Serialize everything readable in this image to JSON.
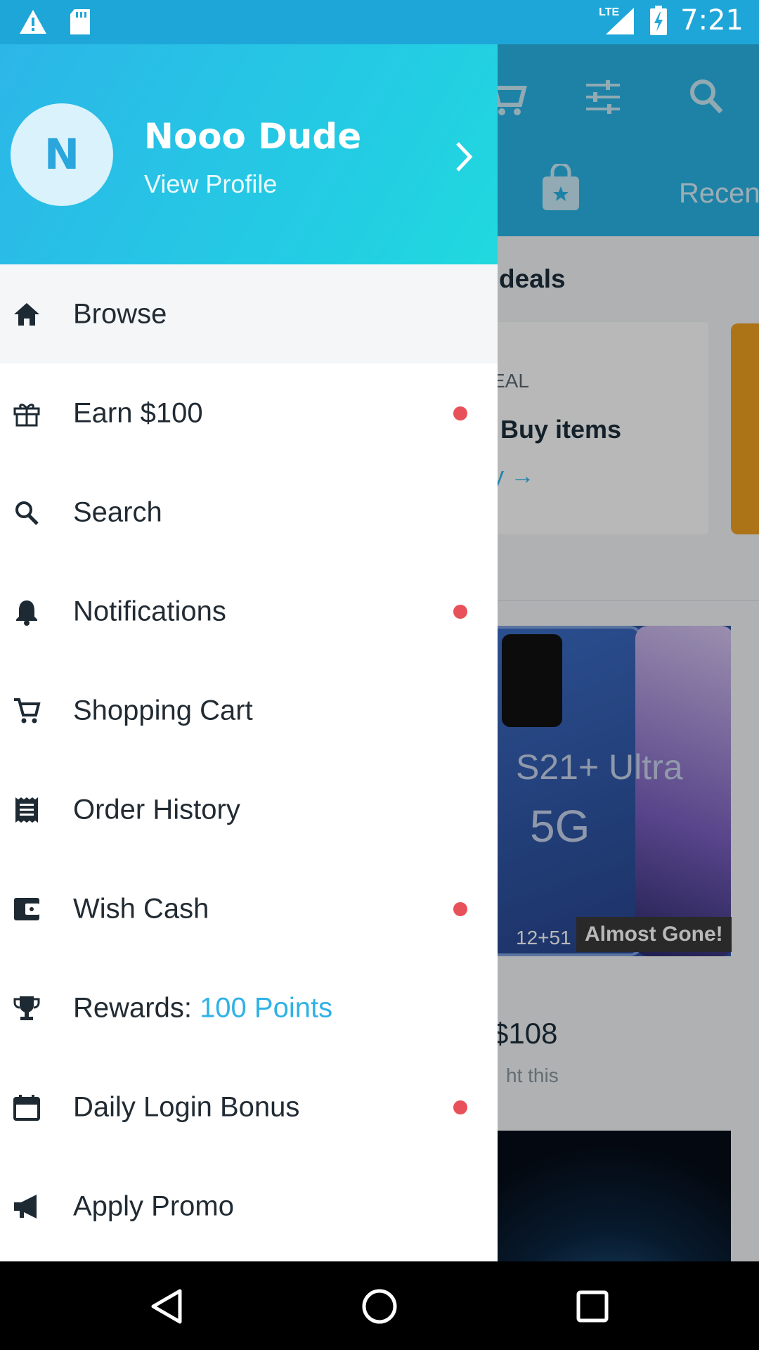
{
  "status_bar": {
    "time": "7:21",
    "network": "LTE",
    "icons": [
      "warning-icon",
      "sd-card-icon",
      "signal-icon",
      "battery-charging-icon"
    ]
  },
  "drawer": {
    "avatar_initial": "N",
    "profile_name": "Nooo Dude",
    "view_profile": "View Profile",
    "menu": [
      {
        "label": "Browse",
        "icon": "home-icon",
        "badge": false,
        "active": true
      },
      {
        "label": "Earn $100",
        "icon": "gift-icon",
        "badge": true
      },
      {
        "label": "Search",
        "icon": "search-icon",
        "badge": false
      },
      {
        "label": "Notifications",
        "icon": "bell-icon",
        "badge": true
      },
      {
        "label": "Shopping Cart",
        "icon": "cart-icon",
        "badge": false
      },
      {
        "label": "Order History",
        "icon": "receipt-icon",
        "badge": false
      },
      {
        "label": "Wish Cash",
        "icon": "wallet-icon",
        "badge": true
      },
      {
        "label": "Rewards: ",
        "points": "100 Points",
        "icon": "trophy-icon",
        "badge": false
      },
      {
        "label": "Daily Login Bonus",
        "icon": "calendar-icon",
        "badge": true
      },
      {
        "label": "Apply Promo",
        "icon": "megaphone-icon",
        "badge": false
      }
    ]
  },
  "background": {
    "tab_label": "Recen",
    "section_title": "deals",
    "card_kicker": "EAL",
    "card_title": "Buy items",
    "card_link": "y →",
    "product_text_1": "S21+ Ultra",
    "product_text_2": "5G",
    "product_mini": "12+51",
    "badge": "Almost Gone!",
    "price": "$108",
    "subtext": "ht this"
  },
  "colors": {
    "header_blue": "#2cb6e8",
    "header_cyan": "#20d9de",
    "accent": "#2fb1e6",
    "badge_red": "#e9515a",
    "status_bar": "#1fa6d9"
  }
}
